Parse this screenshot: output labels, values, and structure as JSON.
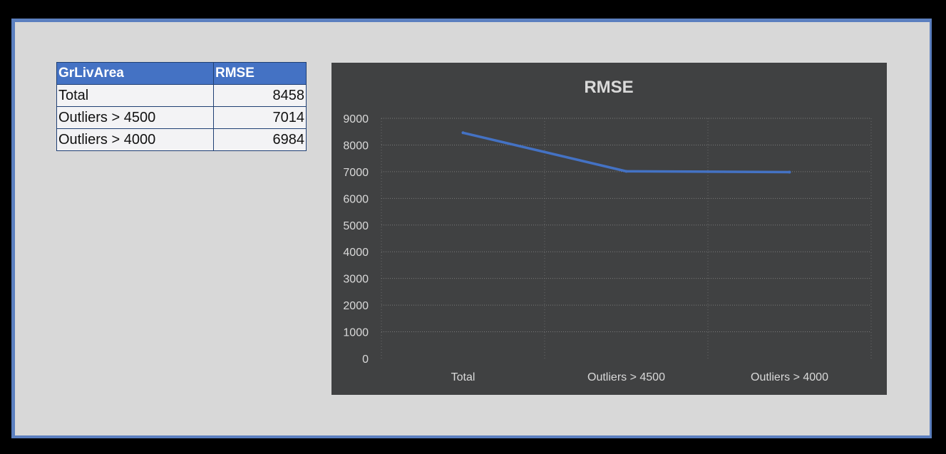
{
  "table": {
    "headers": [
      "GrLivArea",
      "RMSE"
    ],
    "rows": [
      {
        "label": "Total",
        "value": "8458"
      },
      {
        "label": "Outliers > 4500",
        "value": "7014"
      },
      {
        "label": "Outliers > 4000",
        "value": "6984"
      }
    ]
  },
  "colors": {
    "background": "#000000",
    "frame_border": "#5b7fbf",
    "canvas": "#d8d8d8",
    "table_header": "#4472c4",
    "chart_background": "#404142",
    "series_line": "#4472c4",
    "gridline": "#7a7a7a",
    "chart_text": "#d9d9d9"
  },
  "chart_data": {
    "type": "line",
    "title": "RMSE",
    "categories": [
      "Total",
      "Outliers > 4500",
      "Outliers > 4000"
    ],
    "series": [
      {
        "values": [
          8458,
          7014,
          6984
        ]
      }
    ],
    "xlabel": "",
    "ylabel": "",
    "ylim": [
      0,
      9000
    ],
    "yticks": [
      "0",
      "1000",
      "2000",
      "3000",
      "4000",
      "5000",
      "6000",
      "7000",
      "8000",
      "9000"
    ],
    "grid": true,
    "legend": "none"
  }
}
